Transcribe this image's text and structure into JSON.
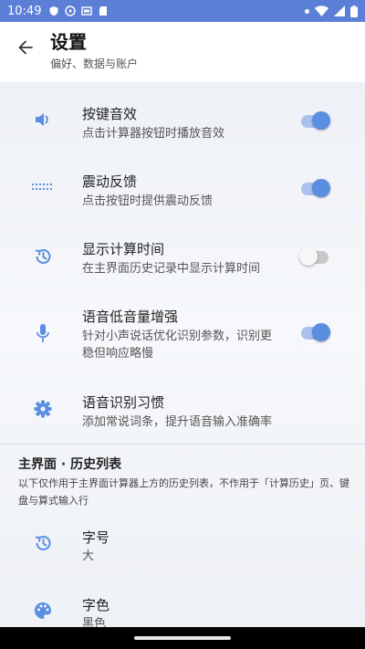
{
  "status_bar": {
    "time": "10:49",
    "left_icons": [
      "shield-icon",
      "play-icon",
      "cast-icon",
      "sd-card-icon"
    ],
    "right_icons": [
      "dot-icon",
      "wifi-icon",
      "signal-icon",
      "battery-icon"
    ]
  },
  "header": {
    "title": "设置",
    "subtitle": "偏好、数据与账户"
  },
  "settings": [
    {
      "label": "按键音效",
      "desc": "点击计算器按钮时播放音效",
      "icon": "volume-icon",
      "toggle": true
    },
    {
      "label": "震动反馈",
      "desc": "点击按钮时提供震动反馈",
      "icon": "vibration-icon",
      "toggle": true
    },
    {
      "label": "显示计算时间",
      "desc": "在主界面历史记录中显示计算时间",
      "icon": "history-icon",
      "toggle": false
    },
    {
      "label": "语音低音量增强",
      "desc": "针对小声说话优化识别参数，识别更稳但响应略慢",
      "icon": "microphone-icon",
      "toggle": true
    },
    {
      "label": "语音识别习惯",
      "desc": "添加常说词条，提升语音输入准确率",
      "icon": "gear-icon"
    }
  ],
  "section": {
    "title": "主界面 · 历史列表",
    "desc": "以下仅作用于主界面计算器上方的历史列表，不作用于「计算历史」页、键盘与算式输入行"
  },
  "history_settings": [
    {
      "label": "字号",
      "value": "大",
      "icon": "history-icon"
    },
    {
      "label": "字色",
      "value": "黑色",
      "icon": "palette-icon"
    }
  ],
  "colors": {
    "accent": "#5b8ee0",
    "status_bar": "#5b7fd6",
    "icon": "#5b8ee0"
  }
}
